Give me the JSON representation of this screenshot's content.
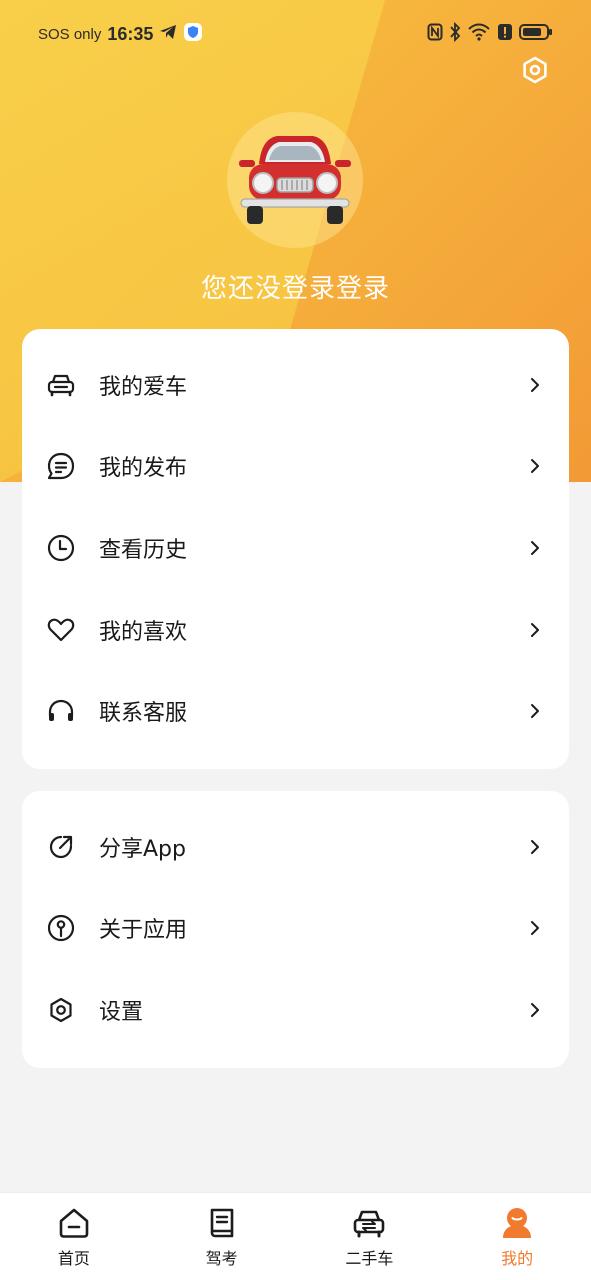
{
  "status_bar": {
    "sos": "SOS only",
    "time": "16:35"
  },
  "header": {
    "guest_text": "您还没登录登录"
  },
  "menu_main": [
    {
      "label": "我的爱车",
      "icon": "car-icon"
    },
    {
      "label": "我的发布",
      "icon": "message-icon"
    },
    {
      "label": "查看历史",
      "icon": "clock-icon"
    },
    {
      "label": "我的喜欢",
      "icon": "heart-icon"
    },
    {
      "label": "联系客服",
      "icon": "headset-icon"
    }
  ],
  "menu_other": [
    {
      "label": "分享App",
      "icon": "share-icon"
    },
    {
      "label": "关于应用",
      "icon": "info-icon"
    },
    {
      "label": "设置",
      "icon": "settings-icon"
    }
  ],
  "tabbar": {
    "items": [
      {
        "label": "首页",
        "icon": "home-icon"
      },
      {
        "label": "驾考",
        "icon": "book-icon"
      },
      {
        "label": "二手车",
        "icon": "used-car-icon"
      },
      {
        "label": "我的",
        "icon": "user-icon"
      }
    ],
    "active": 3
  },
  "colors": {
    "accent": "#f07a2e",
    "header_start": "#f9cc45",
    "header_end": "#f29a36"
  }
}
